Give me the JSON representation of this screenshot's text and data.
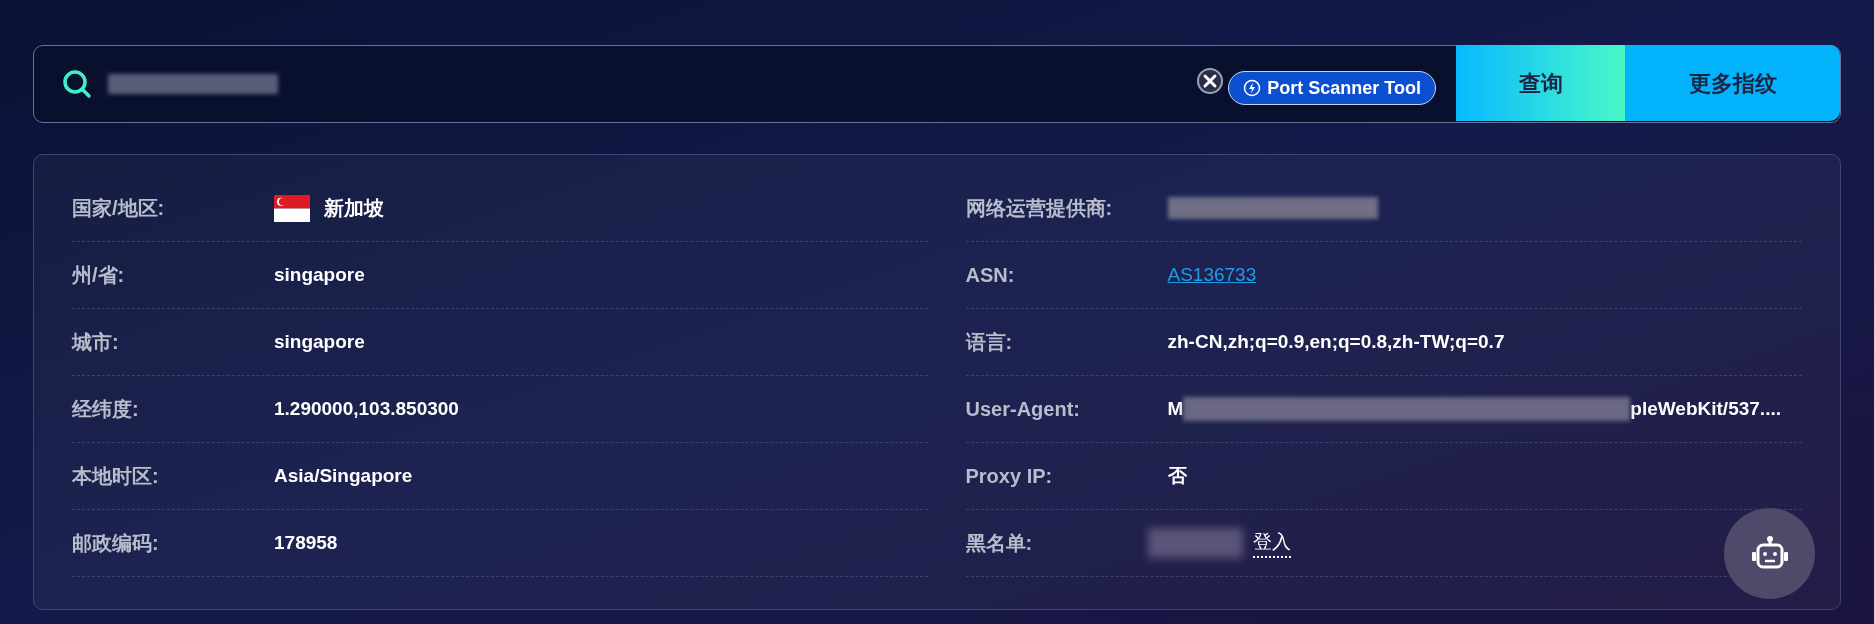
{
  "search": {
    "redacted": true,
    "tool_badge": "Port Scanner Tool",
    "buttons": [
      {
        "label": "查询",
        "kind": "gradient"
      },
      {
        "label": "更多指纹",
        "kind": "solid"
      }
    ]
  },
  "left_rows": [
    {
      "label": "国家/地区:",
      "value": "新加坡",
      "kind": "country"
    },
    {
      "label": "州/省:",
      "value": "singapore",
      "kind": "text"
    },
    {
      "label": "城市:",
      "value": "singapore",
      "kind": "text"
    },
    {
      "label": "经纬度:",
      "value": "1.290000,103.850300",
      "kind": "text"
    },
    {
      "label": "本地时区:",
      "value": "Asia/Singapore",
      "kind": "text"
    },
    {
      "label": "邮政编码:",
      "value": "178958",
      "kind": "text"
    }
  ],
  "right_rows": [
    {
      "label": "网络运营提供商:",
      "kind": "redacted"
    },
    {
      "label": "ASN:",
      "value": "AS136733",
      "kind": "link"
    },
    {
      "label": "语言:",
      "value": "zh-CN,zh;q=0.9,en;q=0.8,zh-TW;q=0.7",
      "kind": "text"
    },
    {
      "label": "User-Agent:",
      "prefix": "M",
      "suffix": "pleWebKit/537....",
      "kind": "partial"
    },
    {
      "label": "Proxy IP:",
      "value": "否",
      "kind": "text"
    },
    {
      "label": "黑名单:",
      "value": "登入",
      "kind": "login"
    }
  ]
}
